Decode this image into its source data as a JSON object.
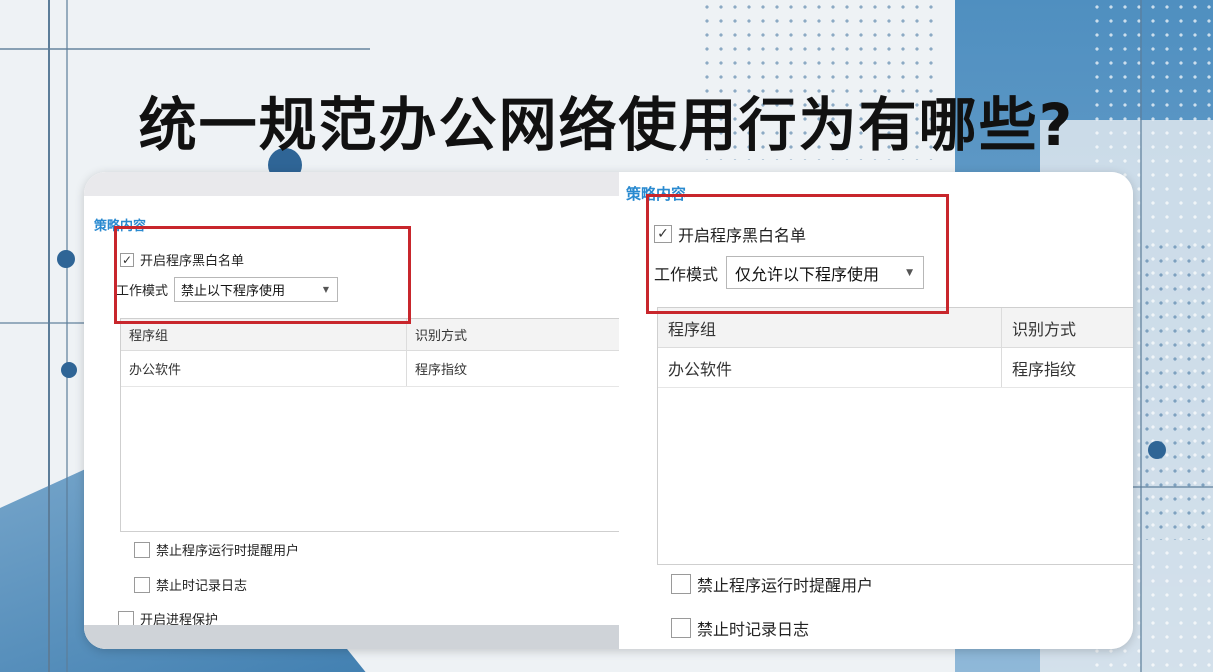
{
  "headline": "统一规范办公网络使用行为有哪些?",
  "colors": {
    "accent": "#2a8ad0",
    "highlight": "#c8262c",
    "headline": "#111111"
  },
  "left_panel": {
    "section_title": "策略内容",
    "enable_blackwhite_list": {
      "label": "开启程序黑白名单",
      "checked": true
    },
    "work_mode": {
      "label": "工作模式",
      "selected": "禁止以下程序使用",
      "icon": "chevron-down-icon"
    },
    "table": {
      "columns": [
        "程序组",
        "识别方式"
      ],
      "rows": [
        [
          "办公软件",
          "程序指纹"
        ]
      ]
    },
    "options": [
      {
        "label": "禁止程序运行时提醒用户",
        "checked": false
      },
      {
        "label": "禁止时记录日志",
        "checked": false
      },
      {
        "label": "开启进程保护",
        "checked": false
      }
    ]
  },
  "right_panel": {
    "section_title": "策略内容",
    "enable_blackwhite_list": {
      "label": "开启程序黑白名单",
      "checked": true
    },
    "work_mode": {
      "label": "工作模式",
      "selected": "仅允许以下程序使用",
      "icon": "chevron-down-icon"
    },
    "table": {
      "columns": [
        "程序组",
        "识别方式"
      ],
      "rows": [
        [
          "办公软件",
          "程序指纹"
        ]
      ]
    },
    "options": [
      {
        "label": "禁止程序运行时提醒用户",
        "checked": false
      },
      {
        "label": "禁止时记录日志",
        "checked": false
      }
    ]
  }
}
